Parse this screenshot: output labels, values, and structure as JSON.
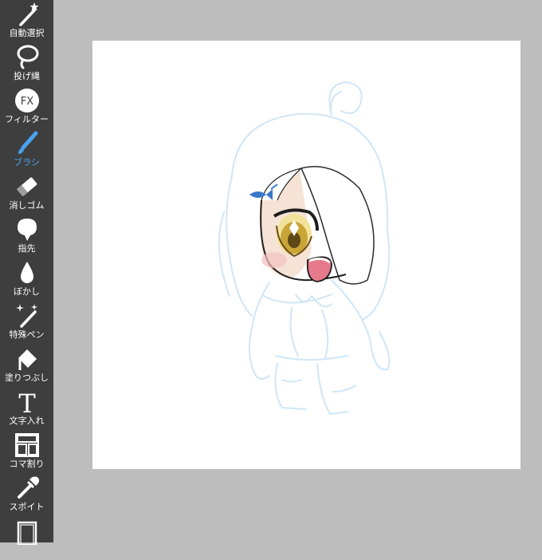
{
  "app": {
    "accent_color": "#4aa3f0",
    "toolbar_bg": "#3e3e3e",
    "workspace_bg": "#bdbdbd"
  },
  "toolbar": {
    "tools": [
      {
        "label": "自動選択",
        "icon": "magic-wand-icon",
        "active": false
      },
      {
        "label": "投げ縄",
        "icon": "lasso-icon",
        "active": false
      },
      {
        "label": "フィルター",
        "icon": "fx-icon",
        "active": false
      },
      {
        "label": "ブラシ",
        "icon": "brush-icon",
        "active": true
      },
      {
        "label": "消しゴム",
        "icon": "eraser-icon",
        "active": false
      },
      {
        "label": "指先",
        "icon": "smudge-icon",
        "active": false
      },
      {
        "label": "ぼかし",
        "icon": "blur-drop-icon",
        "active": false
      },
      {
        "label": "特殊ペン",
        "icon": "special-pen-icon",
        "active": false
      },
      {
        "label": "塗りつぶし",
        "icon": "fill-bucket-icon",
        "active": false
      },
      {
        "label": "文字入れ",
        "icon": "text-icon",
        "active": false
      },
      {
        "label": "コマ割り",
        "icon": "panel-split-icon",
        "active": false
      },
      {
        "label": "スポイト",
        "icon": "eyedropper-icon",
        "active": false
      },
      {
        "label": "",
        "icon": "frame-icon",
        "active": false
      }
    ],
    "fx_text": "FX",
    "text_tool_glyph": "T"
  },
  "canvas": {
    "artwork": "chibi-character-sketch"
  }
}
